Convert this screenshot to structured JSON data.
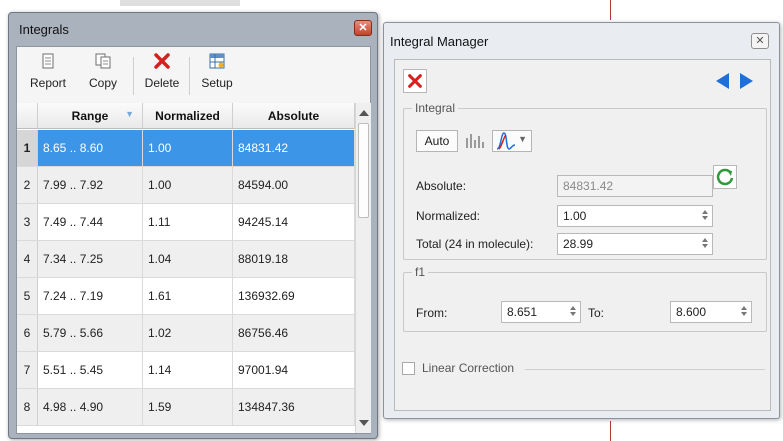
{
  "integrals_window": {
    "title": "Integrals",
    "toolbar": {
      "report_label": "Report",
      "copy_label": "Copy",
      "delete_label": "Delete",
      "setup_label": "Setup"
    },
    "columns": [
      "Range",
      "Normalized",
      "Absolute"
    ],
    "rows": [
      {
        "num": "1",
        "range": "8.65 .. 8.60",
        "normalized": "1.00",
        "absolute": "84831.42"
      },
      {
        "num": "2",
        "range": "7.99 .. 7.92",
        "normalized": "1.00",
        "absolute": "84594.00"
      },
      {
        "num": "3",
        "range": "7.49 .. 7.44",
        "normalized": "1.11",
        "absolute": "94245.14"
      },
      {
        "num": "4",
        "range": "7.34 .. 7.25",
        "normalized": "1.04",
        "absolute": "88019.18"
      },
      {
        "num": "5",
        "range": "7.24 .. 7.19",
        "normalized": "1.61",
        "absolute": "136932.69"
      },
      {
        "num": "6",
        "range": "5.79 .. 5.66",
        "normalized": "1.02",
        "absolute": "86756.46"
      },
      {
        "num": "7",
        "range": "5.51 .. 5.45",
        "normalized": "1.14",
        "absolute": "97001.94"
      },
      {
        "num": "8",
        "range": "4.98 .. 4.90",
        "normalized": "1.59",
        "absolute": "134847.36"
      }
    ],
    "selected_row": 1
  },
  "manager_window": {
    "title": "Integral Manager",
    "integral_group": {
      "title": "Integral",
      "auto_label": "Auto",
      "absolute_label": "Absolute:",
      "absolute_value": "84831.42",
      "normalized_label": "Normalized:",
      "normalized_value": "1.00",
      "total_label": "Total (24 in molecule):",
      "total_value": "28.99"
    },
    "f1_group": {
      "title": "f1",
      "from_label": "From:",
      "from_value": "8.651",
      "to_label": "To:",
      "to_value": "8.600"
    },
    "linear_correction_label": "Linear Correction",
    "linear_correction_checked": false
  },
  "colors": {
    "selection": "#3d95e8",
    "accent_blue": "#1f6fd8",
    "delete_red": "#d62020",
    "refresh_green": "#2e9a3a"
  }
}
